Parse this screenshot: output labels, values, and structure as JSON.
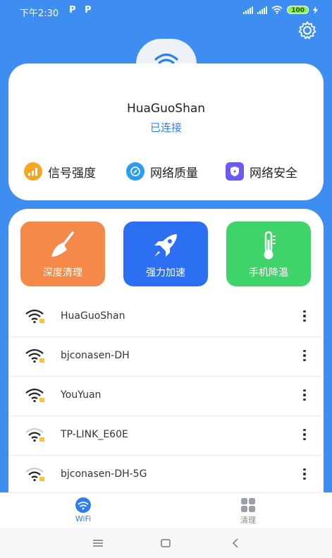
{
  "status": {
    "time": "下午2:30",
    "carrier_icon": "P",
    "battery": "100"
  },
  "network": {
    "name": "HuaGuoShan",
    "status": "已连接"
  },
  "features": [
    {
      "label": "信号强度",
      "icon": "signal-strength-icon",
      "color": "#f5a623"
    },
    {
      "label": "网络质量",
      "icon": "compass-icon",
      "color": "#2d9cf0"
    },
    {
      "label": "网络安全",
      "icon": "shield-icon",
      "color": "#6a5cf0"
    }
  ],
  "tiles": [
    {
      "label": "深度清理",
      "icon": "broom-icon",
      "color": "#f5894a"
    },
    {
      "label": "强力加速",
      "icon": "rocket-icon",
      "color": "#2d6ff2"
    },
    {
      "label": "手机降温",
      "icon": "thermometer-icon",
      "color": "#3ed46a"
    }
  ],
  "wifi_list": [
    {
      "name": "HuaGuoShan"
    },
    {
      "name": "bjconasen-DH"
    },
    {
      "name": "YouYuan"
    },
    {
      "name": "TP-LINK_E60E"
    },
    {
      "name": "bjconasen-DH-5G"
    }
  ],
  "tabs": [
    {
      "label": "WiFi",
      "active": true
    },
    {
      "label": "清理",
      "active": false
    }
  ],
  "colors": {
    "accent": "#2d7ef0",
    "background": "#3d8ef0",
    "lock_badge": "#f5c242"
  }
}
